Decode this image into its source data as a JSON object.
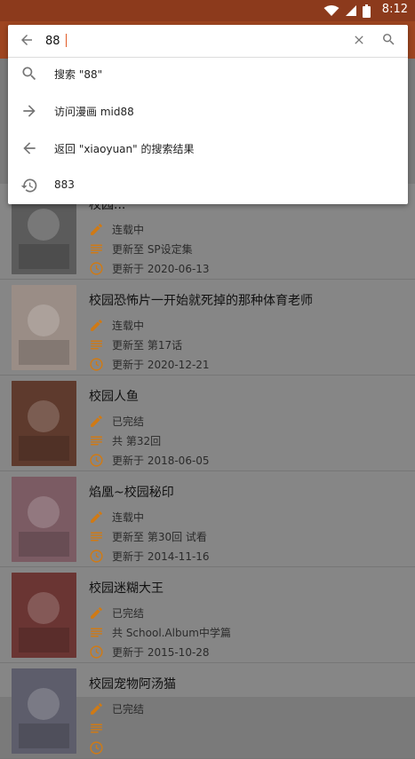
{
  "status_bar": {
    "time": "8:12"
  },
  "search": {
    "query": "88",
    "suggestions": [
      {
        "icon": "search-icon",
        "text": "搜索 \"88\""
      },
      {
        "icon": "arrow-right-icon",
        "text": "访问漫画 mid88"
      },
      {
        "icon": "arrow-left-icon",
        "text": "返回 \"xiaoyuan\" 的搜索结果"
      },
      {
        "icon": "history-icon",
        "text": "883"
      }
    ]
  },
  "results": [
    {
      "title": "校园...",
      "status": "连载中",
      "latest": "更新至 SP设定集",
      "updated": "更新于 2020-06-13",
      "cover_color": "#5b5b5b"
    },
    {
      "title": "校园恐怖片一开始就死掉的那种体育老师",
      "status": "连载中",
      "latest": "更新至 第17话",
      "updated": "更新于 2020-12-21",
      "cover_color": "#9a8d86"
    },
    {
      "title": "校园人鱼",
      "status": "已完结",
      "latest": "共 第32回",
      "updated": "更新于 2018-06-05",
      "cover_color": "#5e3a2d"
    },
    {
      "title": "焰凰~校园秘印",
      "status": "连载中",
      "latest": "更新至 第30回 试看",
      "updated": "更新于 2014-11-16",
      "cover_color": "#7b5b63"
    },
    {
      "title": "校园迷糊大王",
      "status": "已完结",
      "latest": "共 School.Album中学篇",
      "updated": "更新于 2015-10-28",
      "cover_color": "#6a3533"
    },
    {
      "title": "校园宠物阿汤猫",
      "status": "已完结",
      "latest": "",
      "updated": "",
      "cover_color": "#5d5d6b"
    }
  ],
  "colors": {
    "accent": "#d07a14",
    "appbar": "#9e4520",
    "statusbar": "#8c3a1c"
  }
}
